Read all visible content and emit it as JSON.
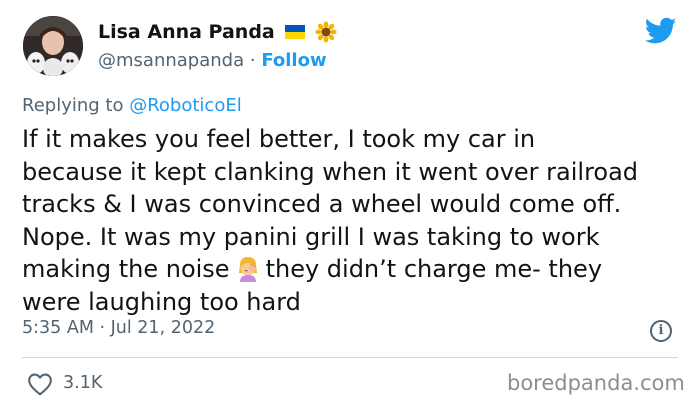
{
  "author": {
    "name": "Lisa Anna Panda",
    "handle": "@msannapanda",
    "separator": "·",
    "follow_label": "Follow"
  },
  "reply": {
    "prefix": "Replying to",
    "mention": "@RoboticoEl"
  },
  "tweet": {
    "text_before_emoji": "If it makes you feel better, I took my car in\nbecause it kept clanking when it went over railroad\ntracks & I was convinced a wheel would come off.\nNope. It was my panini grill I was taking to work\nmaking the noise",
    "text_after_emoji": "they didn’t charge me- they\nwere laughing too hard",
    "emoji": "facepalm-emoji"
  },
  "meta": {
    "timestamp": "5:35 AM · Jul 21, 2022"
  },
  "actions": {
    "like_count": "3.1K"
  },
  "watermark": "boredpanda.com",
  "colors": {
    "accent": "#1d9bf0",
    "secondary_text": "#536471",
    "primary_text": "#0f1419",
    "divider": "#cfd9de"
  },
  "icons": {
    "flag": "ukraine-flag-icon",
    "flower": "sunflower-icon",
    "brand": "twitter-bird-icon",
    "info": "info-icon",
    "like": "heart-icon"
  }
}
